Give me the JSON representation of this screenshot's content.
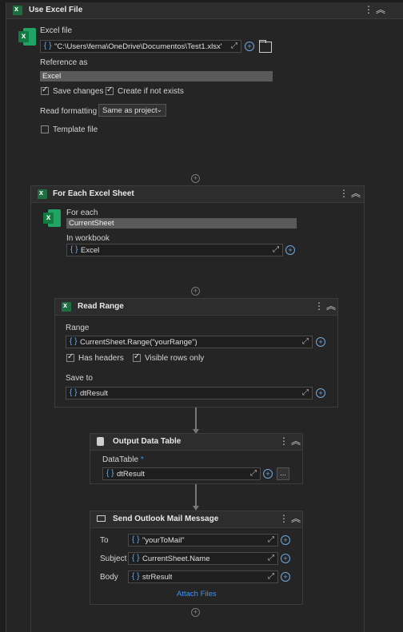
{
  "use_excel": {
    "title": "Use Excel File",
    "excel_file_label": "Excel file",
    "excel_file_value": "\"C:\\Users\\ferna\\OneDrive\\Documentos\\Test1.xlsx\"",
    "reference_label": "Reference as",
    "reference_value": "Excel",
    "save_changes": "Save changes",
    "save_changes_checked": true,
    "create_if_not_exists": "Create if not exists",
    "create_checked": true,
    "read_formatting_label": "Read formatting",
    "read_formatting_value": "Same as project",
    "template_file": "Template file",
    "template_checked": false
  },
  "for_each_sheet": {
    "title": "For Each Excel Sheet",
    "for_each_label": "For each",
    "for_each_value": "CurrentSheet",
    "in_workbook_label": "In workbook",
    "in_workbook_value": "Excel"
  },
  "read_range": {
    "title": "Read Range",
    "range_label": "Range",
    "range_value": "CurrentSheet.Range(\"yourRange\")",
    "has_headers": "Has headers",
    "has_headers_checked": true,
    "visible_rows": "Visible rows only",
    "visible_rows_checked": true,
    "save_to_label": "Save to",
    "save_to_value": "dtResult"
  },
  "output_table": {
    "title": "Output Data Table",
    "datatable_label": "DataTable",
    "required_mark": "*",
    "datatable_value": "dtResult",
    "more_button": "..."
  },
  "send_mail": {
    "title": "Send Outlook Mail Message",
    "to_label": "To",
    "to_value": "\"yourToMail\"",
    "subject_label": "Subject",
    "subject_value": "CurrentSheet.Name",
    "body_label": "Body",
    "body_value": "strResult",
    "attach_files": "Attach Files"
  },
  "icons": {
    "excel": "excel-icon",
    "kebab": "kebab-menu-icon",
    "collapse": "collapse-icon",
    "add": "add-activity-icon",
    "plus": "plus-icon",
    "expand": "expand-editor-icon",
    "folder": "folder-icon",
    "datatable": "database-icon",
    "mail": "mail-icon"
  },
  "colors": {
    "background": "#1e1e1e",
    "card": "#252526",
    "accent": "#3794ff",
    "excel_green": "#107c41"
  },
  "glyphs": {
    "kebab": "⋮",
    "collapse": "︽",
    "plus": "+",
    "brace": "{ }",
    "expand": "⤢",
    "chevron": "⌄"
  }
}
